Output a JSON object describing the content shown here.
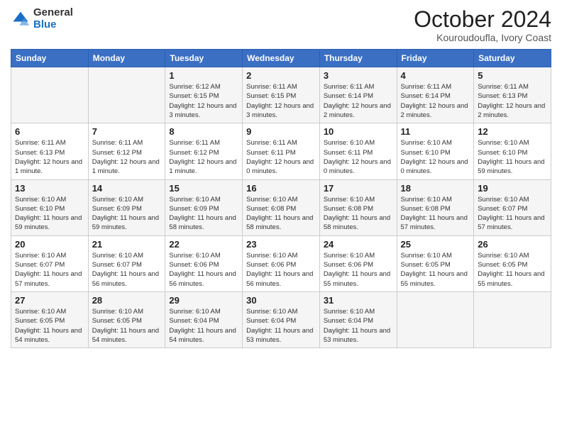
{
  "logo": {
    "general": "General",
    "blue": "Blue"
  },
  "header": {
    "month": "October 2024",
    "location": "Kouroudoufla, Ivory Coast"
  },
  "weekdays": [
    "Sunday",
    "Monday",
    "Tuesday",
    "Wednesday",
    "Thursday",
    "Friday",
    "Saturday"
  ],
  "weeks": [
    [
      {
        "day": "",
        "detail": ""
      },
      {
        "day": "",
        "detail": ""
      },
      {
        "day": "1",
        "detail": "Sunrise: 6:12 AM\nSunset: 6:15 PM\nDaylight: 12 hours\nand 3 minutes."
      },
      {
        "day": "2",
        "detail": "Sunrise: 6:11 AM\nSunset: 6:15 PM\nDaylight: 12 hours\nand 3 minutes."
      },
      {
        "day": "3",
        "detail": "Sunrise: 6:11 AM\nSunset: 6:14 PM\nDaylight: 12 hours\nand 2 minutes."
      },
      {
        "day": "4",
        "detail": "Sunrise: 6:11 AM\nSunset: 6:14 PM\nDaylight: 12 hours\nand 2 minutes."
      },
      {
        "day": "5",
        "detail": "Sunrise: 6:11 AM\nSunset: 6:13 PM\nDaylight: 12 hours\nand 2 minutes."
      }
    ],
    [
      {
        "day": "6",
        "detail": "Sunrise: 6:11 AM\nSunset: 6:13 PM\nDaylight: 12 hours\nand 1 minute."
      },
      {
        "day": "7",
        "detail": "Sunrise: 6:11 AM\nSunset: 6:12 PM\nDaylight: 12 hours\nand 1 minute."
      },
      {
        "day": "8",
        "detail": "Sunrise: 6:11 AM\nSunset: 6:12 PM\nDaylight: 12 hours\nand 1 minute."
      },
      {
        "day": "9",
        "detail": "Sunrise: 6:11 AM\nSunset: 6:11 PM\nDaylight: 12 hours\nand 0 minutes."
      },
      {
        "day": "10",
        "detail": "Sunrise: 6:10 AM\nSunset: 6:11 PM\nDaylight: 12 hours\nand 0 minutes."
      },
      {
        "day": "11",
        "detail": "Sunrise: 6:10 AM\nSunset: 6:10 PM\nDaylight: 12 hours\nand 0 minutes."
      },
      {
        "day": "12",
        "detail": "Sunrise: 6:10 AM\nSunset: 6:10 PM\nDaylight: 11 hours\nand 59 minutes."
      }
    ],
    [
      {
        "day": "13",
        "detail": "Sunrise: 6:10 AM\nSunset: 6:10 PM\nDaylight: 11 hours\nand 59 minutes."
      },
      {
        "day": "14",
        "detail": "Sunrise: 6:10 AM\nSunset: 6:09 PM\nDaylight: 11 hours\nand 59 minutes."
      },
      {
        "day": "15",
        "detail": "Sunrise: 6:10 AM\nSunset: 6:09 PM\nDaylight: 11 hours\nand 58 minutes."
      },
      {
        "day": "16",
        "detail": "Sunrise: 6:10 AM\nSunset: 6:08 PM\nDaylight: 11 hours\nand 58 minutes."
      },
      {
        "day": "17",
        "detail": "Sunrise: 6:10 AM\nSunset: 6:08 PM\nDaylight: 11 hours\nand 58 minutes."
      },
      {
        "day": "18",
        "detail": "Sunrise: 6:10 AM\nSunset: 6:08 PM\nDaylight: 11 hours\nand 57 minutes."
      },
      {
        "day": "19",
        "detail": "Sunrise: 6:10 AM\nSunset: 6:07 PM\nDaylight: 11 hours\nand 57 minutes."
      }
    ],
    [
      {
        "day": "20",
        "detail": "Sunrise: 6:10 AM\nSunset: 6:07 PM\nDaylight: 11 hours\nand 57 minutes."
      },
      {
        "day": "21",
        "detail": "Sunrise: 6:10 AM\nSunset: 6:07 PM\nDaylight: 11 hours\nand 56 minutes."
      },
      {
        "day": "22",
        "detail": "Sunrise: 6:10 AM\nSunset: 6:06 PM\nDaylight: 11 hours\nand 56 minutes."
      },
      {
        "day": "23",
        "detail": "Sunrise: 6:10 AM\nSunset: 6:06 PM\nDaylight: 11 hours\nand 56 minutes."
      },
      {
        "day": "24",
        "detail": "Sunrise: 6:10 AM\nSunset: 6:06 PM\nDaylight: 11 hours\nand 55 minutes."
      },
      {
        "day": "25",
        "detail": "Sunrise: 6:10 AM\nSunset: 6:05 PM\nDaylight: 11 hours\nand 55 minutes."
      },
      {
        "day": "26",
        "detail": "Sunrise: 6:10 AM\nSunset: 6:05 PM\nDaylight: 11 hours\nand 55 minutes."
      }
    ],
    [
      {
        "day": "27",
        "detail": "Sunrise: 6:10 AM\nSunset: 6:05 PM\nDaylight: 11 hours\nand 54 minutes."
      },
      {
        "day": "28",
        "detail": "Sunrise: 6:10 AM\nSunset: 6:05 PM\nDaylight: 11 hours\nand 54 minutes."
      },
      {
        "day": "29",
        "detail": "Sunrise: 6:10 AM\nSunset: 6:04 PM\nDaylight: 11 hours\nand 54 minutes."
      },
      {
        "day": "30",
        "detail": "Sunrise: 6:10 AM\nSunset: 6:04 PM\nDaylight: 11 hours\nand 53 minutes."
      },
      {
        "day": "31",
        "detail": "Sunrise: 6:10 AM\nSunset: 6:04 PM\nDaylight: 11 hours\nand 53 minutes."
      },
      {
        "day": "",
        "detail": ""
      },
      {
        "day": "",
        "detail": ""
      }
    ]
  ]
}
